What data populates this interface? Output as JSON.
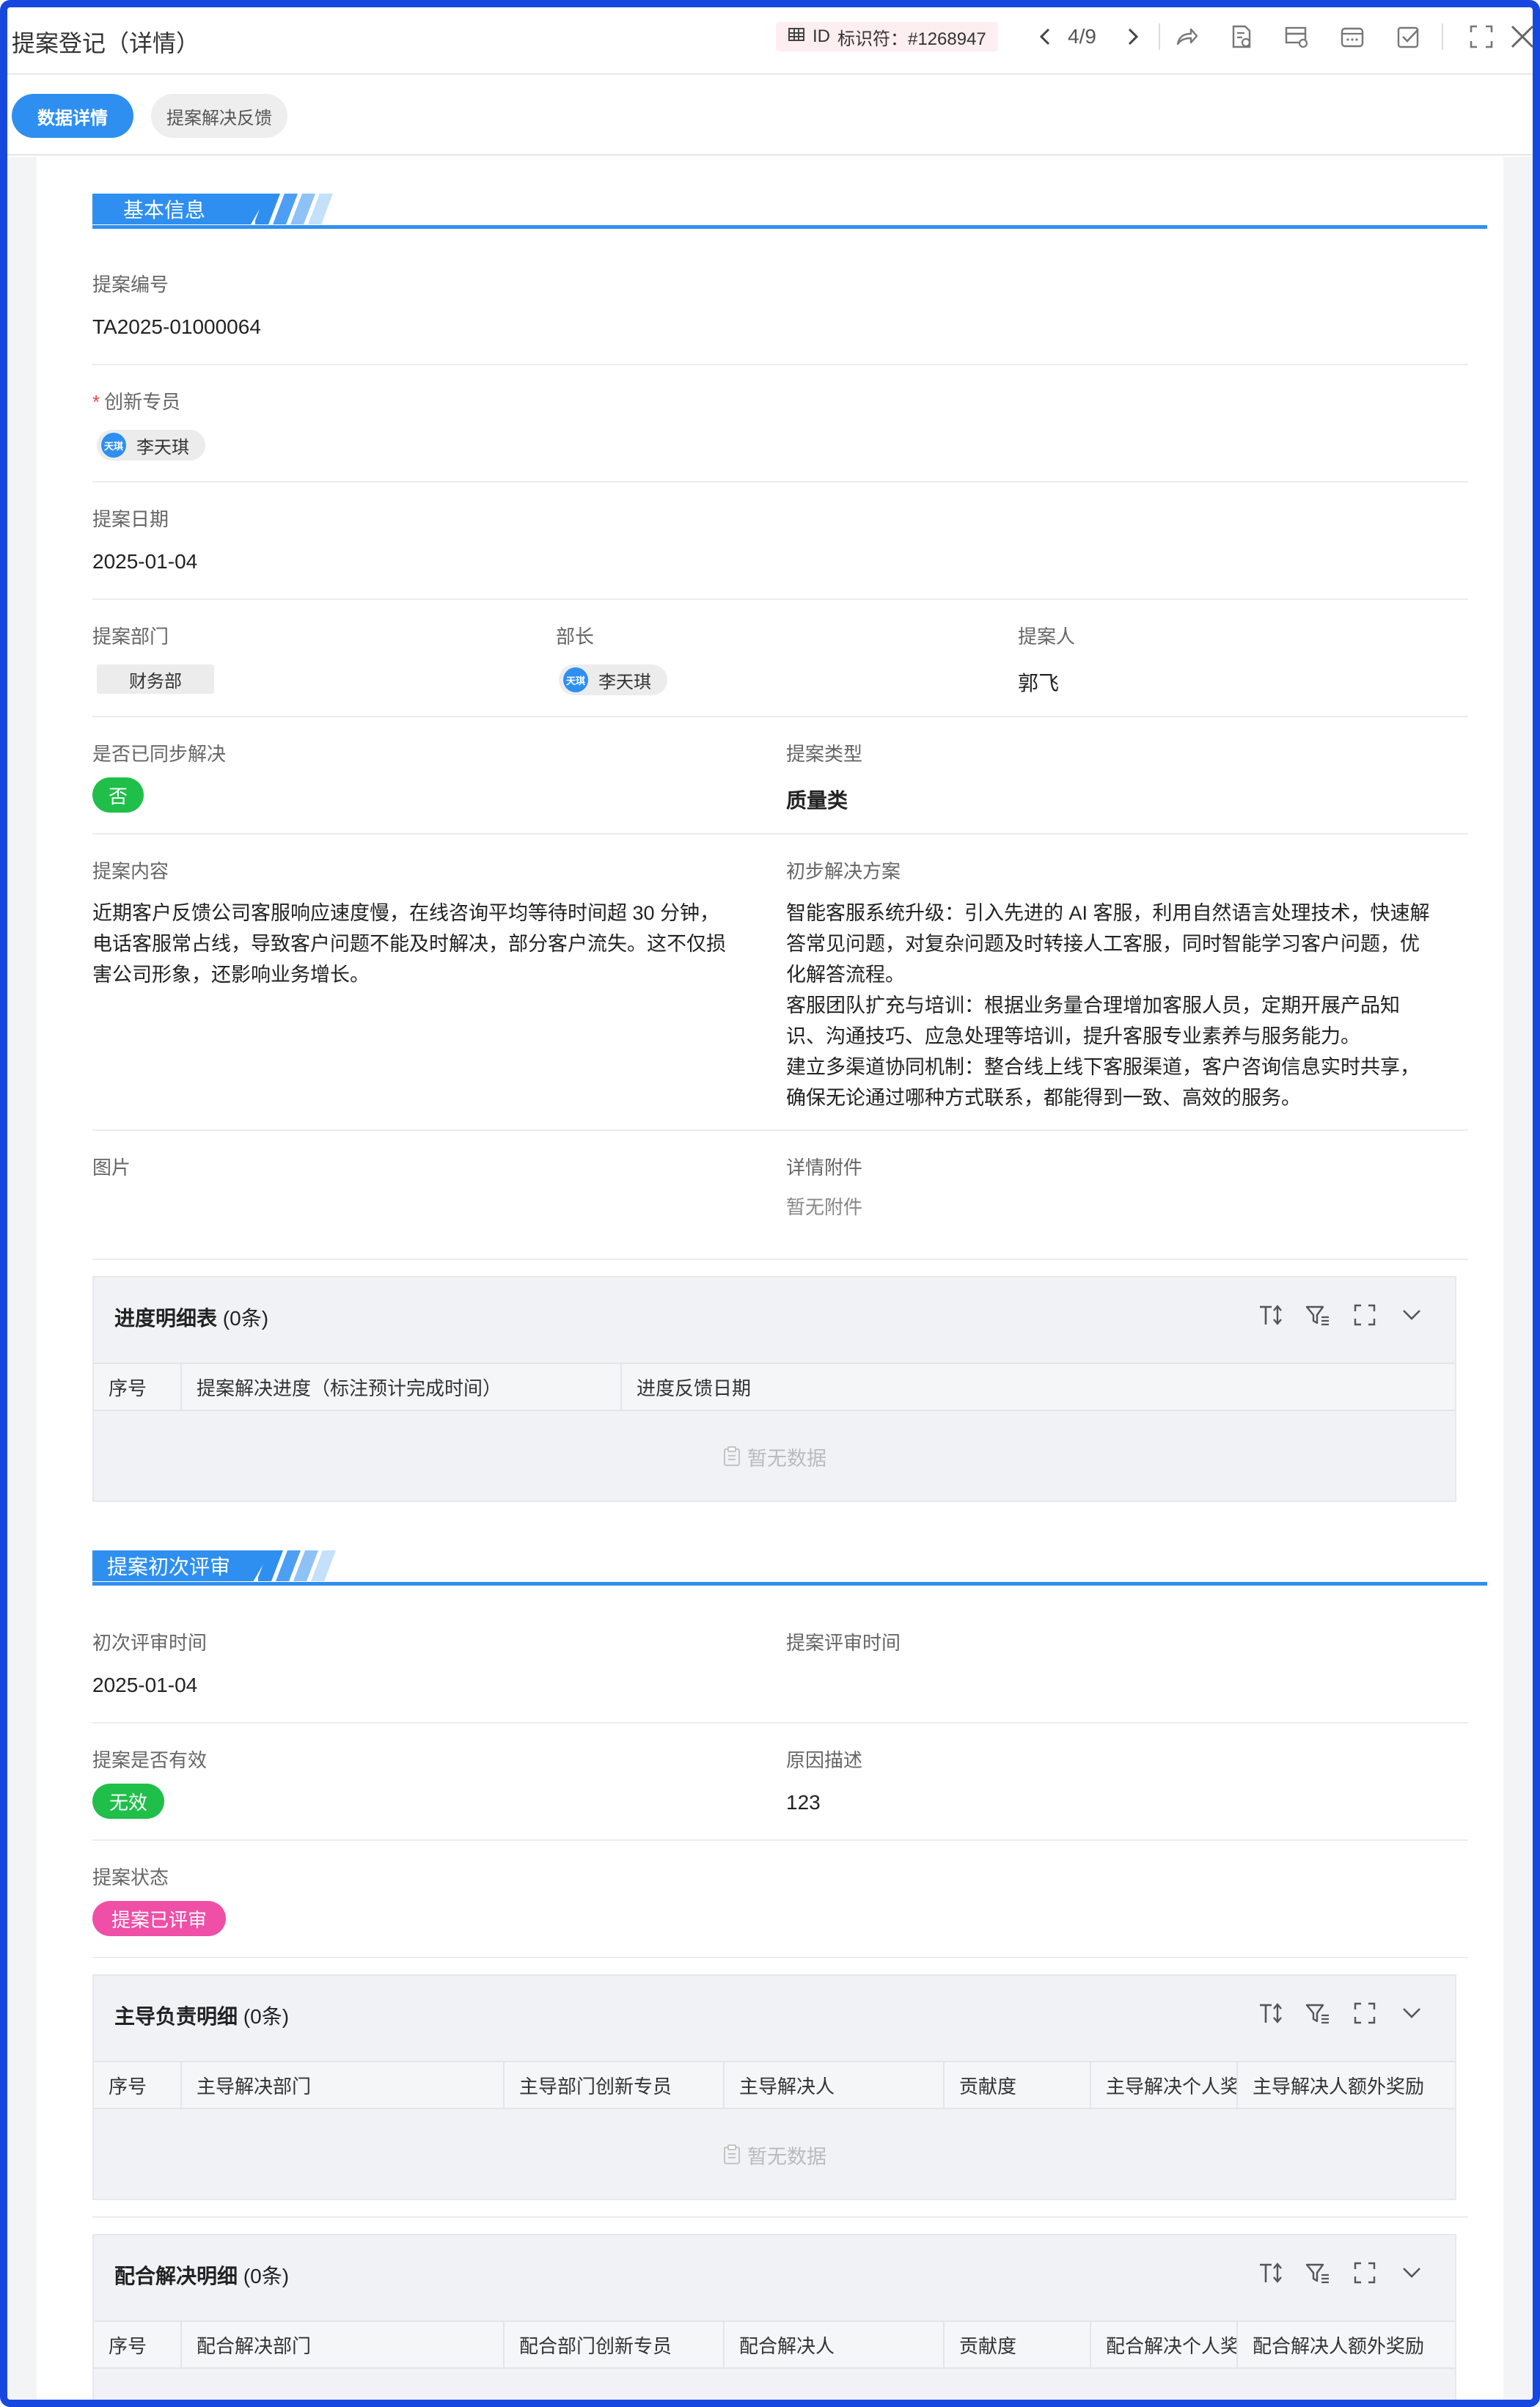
{
  "window": {
    "title": "提案登记（详情）"
  },
  "toolbar": {
    "id_label": "ID",
    "id_text": "标识符：#1268947",
    "pager": "4/9"
  },
  "tabs": [
    {
      "label": "数据详情",
      "active": true
    },
    {
      "label": "提案解决反馈",
      "active": false
    }
  ],
  "section_basic": {
    "title": "基本信息",
    "proposal_no_label": "提案编号",
    "proposal_no": "TA2025-01000064",
    "specialist_label": "创新专员",
    "specialist": {
      "avatar": "天琪",
      "name": "李天琪"
    },
    "date_label": "提案日期",
    "date": "2025-01-04",
    "dept_label": "提案部门",
    "dept": "财务部",
    "minister_label": "部长",
    "minister": {
      "avatar": "天琪",
      "name": "李天琪"
    },
    "proposer_label": "提案人",
    "proposer": "郭飞",
    "resolved_label": "是否已同步解决",
    "resolved": "否",
    "type_label": "提案类型",
    "type": "质量类",
    "content_label": "提案内容",
    "content_lines": [
      "近期客户反馈公司客服响应速度慢，在线咨询平均等待时间超 30 分钟，",
      "电话客服常占线，导致客户问题不能及时解决，部分客户流失。这不仅损",
      "害公司形象，还影响业务增长。"
    ],
    "solution_label": "初步解决方案",
    "solution_lines": [
      "智能客服系统升级：引入先进的 AI 客服，利用自然语言处理技术，快速解",
      "答常见问题，对复杂问题及时转接人工客服，同时智能学习客户问题，优",
      "化解答流程。",
      "客服团队扩充与培训：根据业务量合理增加客服人员，定期开展产品知",
      "识、沟通技巧、应急处理等培训，提升客服专业素养与服务能力。",
      "建立多渠道协同机制：整合线上线下客服渠道，客户咨询信息实时共享，",
      "确保无论通过哪种方式联系，都能得到一致、高效的服务。"
    ],
    "image_label": "图片",
    "attachment_label": "详情附件",
    "attachment_empty": "暂无附件"
  },
  "progress_table": {
    "title": "进度明细表",
    "count": "(0条)",
    "columns": [
      "序号",
      "提案解决进度（标注预计完成时间）",
      "进度反馈日期"
    ],
    "empty": "暂无数据"
  },
  "section_review": {
    "title": "提案初次评审",
    "first_review_label": "初次评审时间",
    "first_review": "2025-01-04",
    "review_time_label": "提案评审时间",
    "valid_label": "提案是否有效",
    "valid": "无效",
    "reason_label": "原因描述",
    "reason": "123",
    "status_label": "提案状态",
    "status": "提案已评审"
  },
  "lead_table": {
    "title": "主导负责明细",
    "count": "(0条)",
    "columns": [
      "序号",
      "主导解决部门",
      "主导部门创新专员",
      "主导解决人",
      "贡献度",
      "主导解决个人奖",
      "主导解决人额外奖励"
    ],
    "empty": "暂无数据"
  },
  "coop_table": {
    "title": "配合解决明细",
    "count": "(0条)",
    "columns": [
      "序号",
      "配合解决部门",
      "配合部门创新专员",
      "配合解决人",
      "贡献度",
      "配合解决个人奖",
      "配合解决人额外奖励"
    ]
  },
  "colors": {
    "primary": "#2e8ff0",
    "no_green": "#1fbf4a",
    "status_pink": "#ef4fa6",
    "frame": "#1648e0"
  }
}
